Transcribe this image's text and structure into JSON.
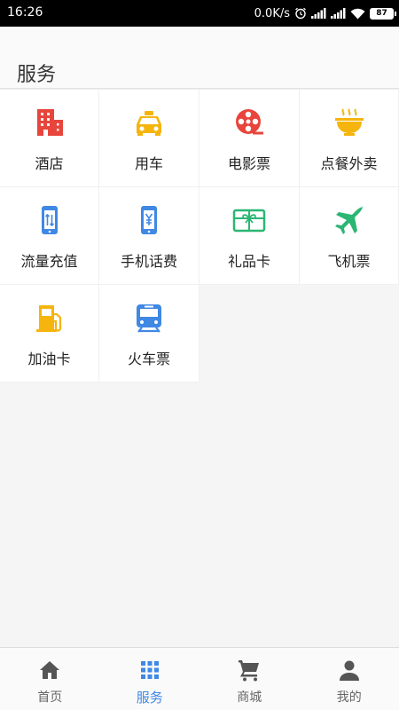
{
  "status_bar": {
    "time": "16:26",
    "network_speed": "0.0K/s",
    "battery": "87",
    "icons": [
      "alarm-icon",
      "signal-icon",
      "signal-icon",
      "wifi-icon",
      "battery-icon"
    ]
  },
  "header": {
    "title": "服务"
  },
  "services": [
    {
      "label": "酒店",
      "icon": "hotel-icon",
      "color": "#e8453c"
    },
    {
      "label": "用车",
      "icon": "taxi-icon",
      "color": "#f5b50e"
    },
    {
      "label": "电影票",
      "icon": "film-reel-icon",
      "color": "#e8453c"
    },
    {
      "label": "点餐外卖",
      "icon": "food-bowl-icon",
      "color": "#f5b50e"
    },
    {
      "label": "流量充值",
      "icon": "data-recharge-icon",
      "color": "#3f88e4"
    },
    {
      "label": "手机话费",
      "icon": "phone-bill-icon",
      "color": "#3f88e4"
    },
    {
      "label": "礼品卡",
      "icon": "gift-card-icon",
      "color": "#2bb673"
    },
    {
      "label": "飞机票",
      "icon": "airplane-icon",
      "color": "#2bb673"
    },
    {
      "label": "加油卡",
      "icon": "fuel-pump-icon",
      "color": "#f5b50e"
    },
    {
      "label": "火车票",
      "icon": "train-icon",
      "color": "#3f88e4"
    }
  ],
  "tabbar": {
    "active_color": "#3f88e4",
    "inactive_color": "#666666",
    "tabs": [
      {
        "label": "首页",
        "icon": "home-icon",
        "active": false
      },
      {
        "label": "服务",
        "icon": "grid-icon",
        "active": true
      },
      {
        "label": "商城",
        "icon": "cart-icon",
        "active": false
      },
      {
        "label": "我的",
        "icon": "person-icon",
        "active": false
      }
    ]
  }
}
